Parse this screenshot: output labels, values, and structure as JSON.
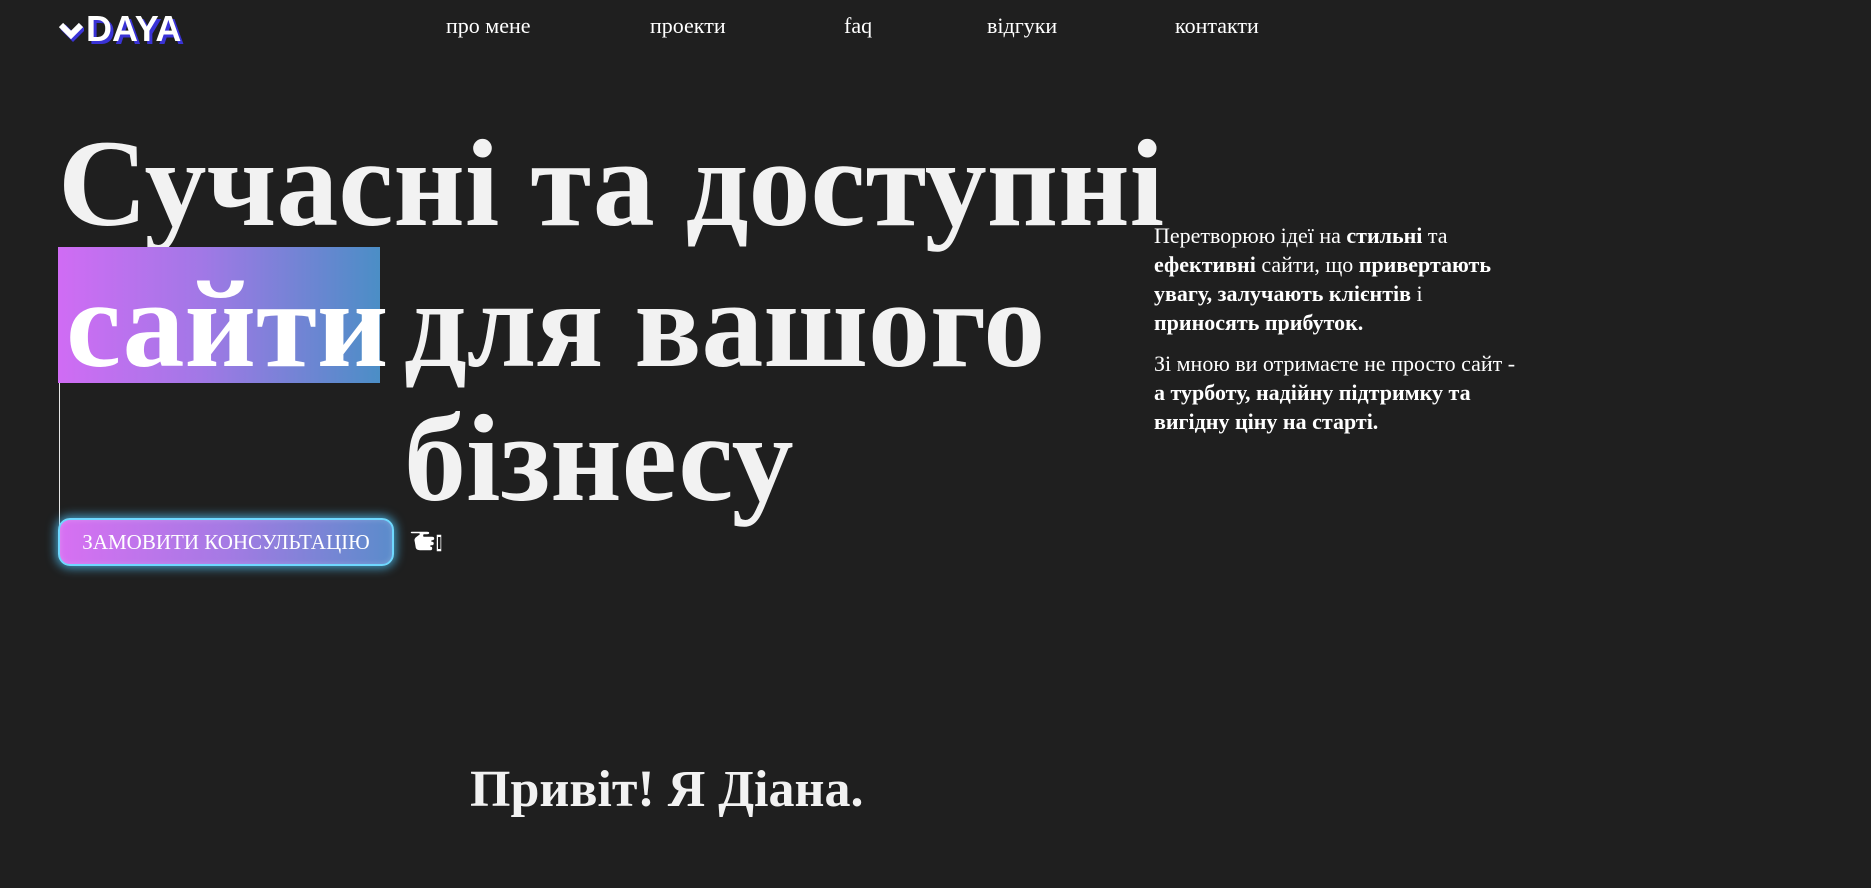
{
  "header": {
    "logo_text": "DAYA",
    "logo_icon": "chevron-down-logo-icon",
    "nav": [
      {
        "label": "про мене"
      },
      {
        "label": "проекти"
      },
      {
        "label": "faq"
      },
      {
        "label": "відгуки"
      },
      {
        "label": "контакти"
      }
    ]
  },
  "hero": {
    "line1": "Сучасні та доступні",
    "highlight_word": "сайти",
    "line2_rest": "для вашого",
    "line3": "бізнесу",
    "cta_label": "ЗАМОВИТИ КОНСУЛЬТАЦІЮ",
    "cta_icon": "pointing-hand-icon"
  },
  "intro": {
    "p1": [
      {
        "text": "Перетворюю ідеї на ",
        "bold": false
      },
      {
        "text": "стильні",
        "bold": true
      },
      {
        "text": " та ",
        "bold": false
      },
      {
        "text": "ефективні",
        "bold": true
      },
      {
        "text": " сайти, що ",
        "bold": false
      },
      {
        "text": "привертають увагу, залучають клієнтів",
        "bold": true
      },
      {
        "text": " і ",
        "bold": false
      },
      {
        "text": "приносять прибуток.",
        "bold": true
      }
    ],
    "p2": [
      {
        "text": "Зі мною ви отримаєте не просто сайт - ",
        "bold": false
      },
      {
        "text": "а турботу, надійну підтримку та вигідну ціну на старті.",
        "bold": true
      }
    ]
  },
  "greeting": "Привіт! Я Діана.",
  "colors": {
    "background": "#1f1f1f",
    "text": "#f2f2f2",
    "logo_shadow": "#3a33d6",
    "gradient_start": "#d06cf4",
    "gradient_end": "#4b8ec6",
    "cta_glow": "#6fd8ff"
  }
}
